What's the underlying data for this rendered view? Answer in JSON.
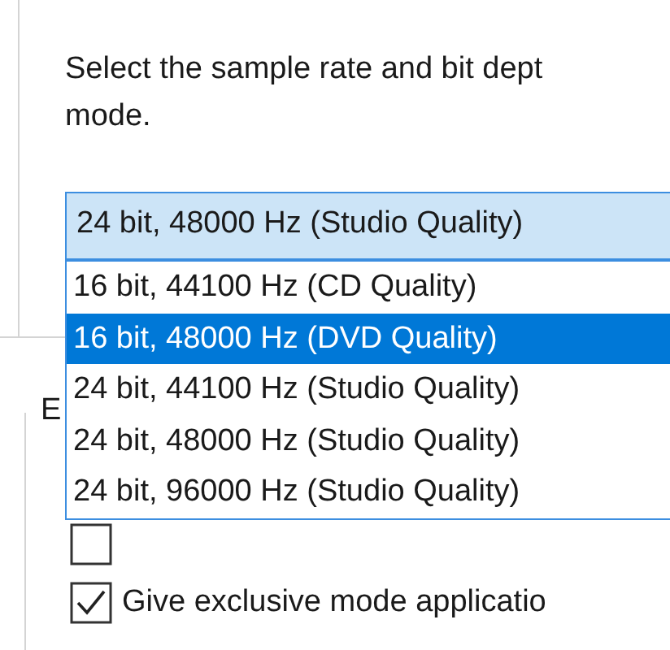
{
  "description": {
    "lines": [
      "Select the sample rate and bit dept",
      "mode."
    ]
  },
  "format_combo": {
    "value": "24 bit, 48000 Hz (Studio Quality)",
    "expanded": true
  },
  "format_options": [
    {
      "label": "16 bit, 44100 Hz (CD Quality)",
      "selected": false
    },
    {
      "label": "16 bit, 48000 Hz (DVD Quality)",
      "selected": true
    },
    {
      "label": "24 bit, 44100 Hz (Studio Quality)",
      "selected": false
    },
    {
      "label": "24 bit, 48000 Hz (Studio Quality)",
      "selected": false
    },
    {
      "label": "24 bit, 96000 Hz (Studio Quality)",
      "selected": false
    }
  ],
  "exclusive_group": {
    "label": "E"
  },
  "checkboxes": [
    {
      "checked": false
    },
    {
      "label": "Give exclusive mode applicatio",
      "checked": true
    }
  ]
}
